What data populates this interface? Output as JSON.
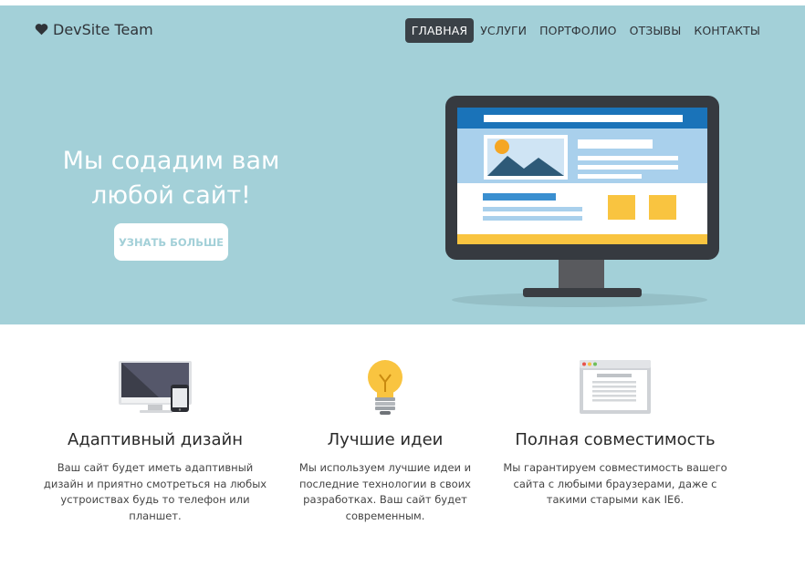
{
  "brand": {
    "name": "DevSite Team",
    "icon": "heart-icon"
  },
  "nav": {
    "items": [
      {
        "label": "Главная",
        "active": true
      },
      {
        "label": "Услуги",
        "active": false
      },
      {
        "label": "Портфолио",
        "active": false
      },
      {
        "label": "Отзывы",
        "active": false
      },
      {
        "label": "Контакты",
        "active": false
      }
    ]
  },
  "hero": {
    "title_line1": "Мы содадим вам",
    "title_line2": "любой сайт!",
    "button_label": "Узнать больше",
    "illustration": "monitor-illustration"
  },
  "features": [
    {
      "icon": "responsive-devices-icon",
      "title": "Адаптивный дизайн",
      "text": "Ваш сайт будет иметь адаптивный дизайн и приятно смотреться на любых устроиствах будь то телефон или планшет."
    },
    {
      "icon": "lightbulb-icon",
      "title": "Лучшие идеи",
      "text": "Мы используем лучшие идеи и последние технологии в своих разработках. Ваш сайт будет современным."
    },
    {
      "icon": "browser-window-icon",
      "title": "Полная совместимость",
      "text": "Мы гарантируем совместимость вашего сайта с любыми браузерами, даже с такими старыми как IE6."
    }
  ],
  "colors": {
    "hero_bg": "#a3d0d8",
    "nav_active_bg": "#3a4147",
    "text_dark": "#2f3338",
    "accent_blue": "#1a73b9",
    "accent_yellow": "#f9c440"
  }
}
